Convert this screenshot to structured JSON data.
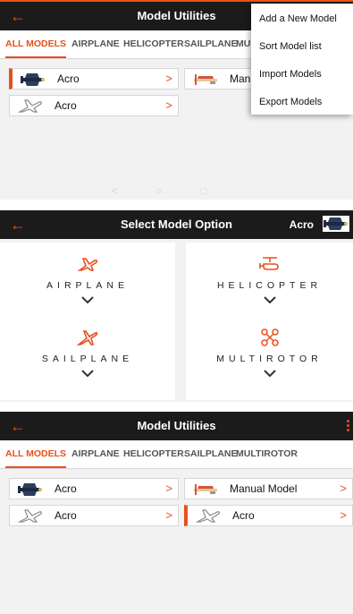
{
  "panel1": {
    "title": "Model Utilities",
    "tabs": [
      "ALL MODELS",
      "AIRPLANE",
      "HELICOPTER",
      "SAILPLANE",
      "MULTIROTOR"
    ],
    "models": [
      {
        "name": "Acro",
        "icon": "warbird-plane-icon",
        "selected": true
      },
      {
        "name": "Acro",
        "icon": "generic-airplane-icon",
        "selected": false
      },
      {
        "name": "Manual Model",
        "icon": "glider-plane-icon",
        "selected": false
      }
    ],
    "menu": [
      "Add a New Model",
      "Sort Model list",
      "Import Models",
      "Export Models"
    ]
  },
  "panel2": {
    "title": "Select Model Option",
    "current_model": "Acro",
    "options": [
      "AIRPLANE",
      "HELICOPTER",
      "SAILPLANE",
      "MULTIROTOR"
    ]
  },
  "panel3": {
    "title": "Model Utilities",
    "tabs": [
      "ALL MODELS",
      "AIRPLANE",
      "HELICOPTER",
      "SAILPLANE",
      "MULTIROTOR"
    ],
    "models": [
      {
        "name": "Acro",
        "icon": "warbird-plane-icon"
      },
      {
        "name": "Acro",
        "icon": "generic-airplane-icon"
      },
      {
        "name": "Manual Model",
        "icon": "glider-plane-icon"
      },
      {
        "name": "Acro",
        "icon": "generic-airplane-icon",
        "selected": true
      }
    ]
  },
  "colors": {
    "accent": "#e8501d",
    "bar": "#1b1b1b"
  }
}
